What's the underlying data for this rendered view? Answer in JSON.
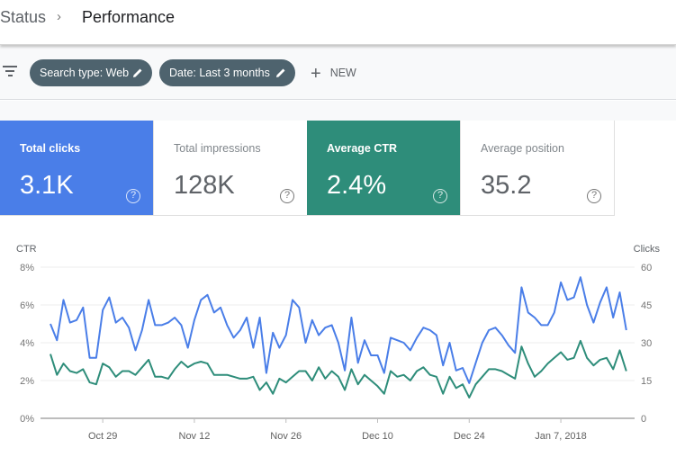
{
  "breadcrumb": {
    "parent": "Status",
    "separator": "›",
    "current": "Performance"
  },
  "filters": {
    "filter_icon": "filter-icon",
    "chips": [
      {
        "label": "Search type: Web",
        "icon": "pencil-icon"
      },
      {
        "label": "Date: Last 3 months",
        "icon": "pencil-icon"
      }
    ],
    "new_label": "NEW",
    "new_icon": "plus-icon"
  },
  "metrics": [
    {
      "label": "Total clicks",
      "value": "3.1K",
      "active": true,
      "color": "#4a7ee8",
      "help": "?"
    },
    {
      "label": "Total impressions",
      "value": "128K",
      "active": false,
      "help": "?"
    },
    {
      "label": "Average CTR",
      "value": "2.4%",
      "active": true,
      "color": "#2e8d7a",
      "help": "?"
    },
    {
      "label": "Average position",
      "value": "35.2",
      "active": false,
      "help": "?"
    }
  ],
  "chart_data": {
    "type": "line",
    "title": "",
    "left_axis": {
      "label": "CTR",
      "ticks": [
        "0%",
        "2%",
        "4%",
        "6%",
        "8%"
      ],
      "range": [
        0,
        8
      ]
    },
    "right_axis": {
      "label": "Clicks",
      "ticks": [
        "0",
        "15",
        "30",
        "45",
        "60"
      ],
      "range": [
        0,
        60
      ]
    },
    "x_ticks": [
      "Oct 29",
      "Nov 12",
      "Nov 26",
      "Dec 10",
      "Dec 24",
      "Jan 7, 2018"
    ],
    "x_start": "2017-10-21",
    "x_tick_day_offsets": [
      8,
      22,
      36,
      50,
      64,
      78
    ],
    "grid": true,
    "legend": "none",
    "series": [
      {
        "name": "Clicks",
        "axis": "right",
        "color": "#4a7ee8",
        "values": [
          37.5,
          31,
          47,
          38,
          39,
          44,
          24,
          24,
          43,
          48,
          38,
          40,
          36,
          27,
          35,
          47,
          37,
          37,
          38,
          40,
          37,
          28,
          39,
          47,
          49,
          42,
          44,
          37,
          32,
          35,
          40,
          28,
          40,
          18,
          34,
          28,
          33,
          47,
          44,
          30,
          39,
          33,
          36,
          37,
          30,
          19,
          40,
          22,
          31,
          25,
          25,
          18,
          32,
          31,
          30,
          27,
          32,
          36,
          35,
          33,
          21,
          30,
          19,
          20,
          14,
          22,
          30,
          35,
          36,
          33,
          29,
          26,
          52,
          42,
          40,
          37,
          37,
          42,
          54,
          47,
          48,
          56,
          45,
          38,
          46,
          52,
          40,
          50,
          35
        ]
      },
      {
        "name": "CTR",
        "axis": "left",
        "color": "#2e8d7a",
        "values": [
          3.4,
          2.3,
          2.9,
          2.5,
          2.4,
          2.6,
          1.9,
          1.8,
          2.9,
          2.7,
          2.2,
          2.5,
          2.5,
          2.3,
          2.7,
          3.1,
          2.2,
          2.2,
          2.1,
          2.6,
          3.0,
          2.7,
          2.9,
          3.0,
          2.9,
          2.3,
          2.3,
          2.3,
          2.2,
          2.1,
          2.1,
          2.2,
          1.5,
          1.9,
          1.3,
          2.1,
          1.9,
          2.2,
          2.5,
          2.5,
          2.0,
          2.7,
          2.1,
          2.5,
          2.2,
          1.5,
          2.6,
          1.8,
          2.3,
          2.0,
          1.7,
          1.3,
          2.5,
          2.2,
          2.3,
          2.0,
          2.5,
          2.7,
          2.3,
          2.2,
          1.3,
          2.2,
          1.6,
          1.8,
          1.1,
          1.8,
          2.2,
          2.6,
          2.6,
          2.5,
          2.3,
          2.1,
          3.8,
          2.9,
          2.2,
          2.5,
          2.9,
          3.2,
          3.5,
          3.1,
          3.2,
          4.1,
          3.2,
          2.8,
          3.1,
          3.2,
          2.6,
          3.6,
          2.5
        ]
      }
    ]
  }
}
